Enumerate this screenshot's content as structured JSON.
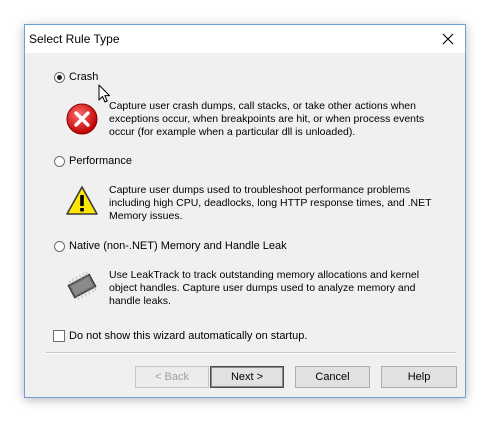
{
  "dialog": {
    "title": "Select Rule Type",
    "close_icon": "close-icon"
  },
  "options": [
    {
      "label": "Crash",
      "checked": true,
      "icon": "error-icon",
      "description": [
        "Capture user crash dumps, call stacks, or take other actions when",
        "exceptions occur, when breakpoints are hit, or when process events",
        "occur (for example when a particular dll is unloaded)."
      ]
    },
    {
      "label": "Performance",
      "checked": false,
      "icon": "warning-icon",
      "description": [
        "Capture user dumps used to troubleshoot performance problems",
        "including high CPU, deadlocks, long HTTP response times, and .NET",
        "Memory issues."
      ]
    },
    {
      "label": "Native (non-.NET) Memory and Handle Leak",
      "checked": false,
      "icon": "memory-chip-icon",
      "description": [
        "Use LeakTrack to track outstanding memory allocations and kernel",
        "object handles. Capture user dumps used to analyze memory and",
        "handle leaks."
      ]
    }
  ],
  "checkbox": {
    "label": "Do not show this wizard automatically on startup.",
    "checked": false
  },
  "buttons": {
    "back": "< Back",
    "next": "Next >",
    "cancel": "Cancel",
    "help": "Help"
  }
}
